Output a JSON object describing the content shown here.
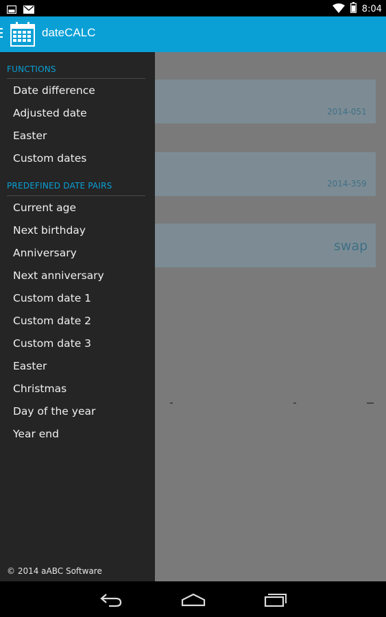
{
  "status_bar": {
    "time": "8:04",
    "icons_left": [
      "gallery-notification-icon",
      "gmail-notification-icon"
    ],
    "icons_right": [
      "wifi-icon",
      "battery-icon"
    ]
  },
  "action_bar": {
    "title": "dateCALC",
    "icon": "calendar-icon",
    "accent_color": "#0aa0d6"
  },
  "background": {
    "card1_code": "2014-051",
    "card2_code": "2014-359",
    "swap_label": "swap"
  },
  "drawer": {
    "sections": [
      {
        "header": "FUNCTIONS",
        "items": [
          "Date difference",
          "Adjusted date",
          "Easter",
          "Custom dates"
        ]
      },
      {
        "header": "PREDEFINED DATE PAIRS",
        "items": [
          "Current age",
          "Next birthday",
          "Anniversary",
          "Next anniversary",
          "Custom date 1",
          "Custom date 2",
          "Custom date 3",
          "Easter",
          "Christmas",
          "Day of the year",
          "Year end"
        ]
      }
    ],
    "copyright": "© 2014 aABC Software"
  },
  "nav_bar": {
    "buttons": [
      "back-icon",
      "home-icon",
      "recents-icon"
    ]
  }
}
